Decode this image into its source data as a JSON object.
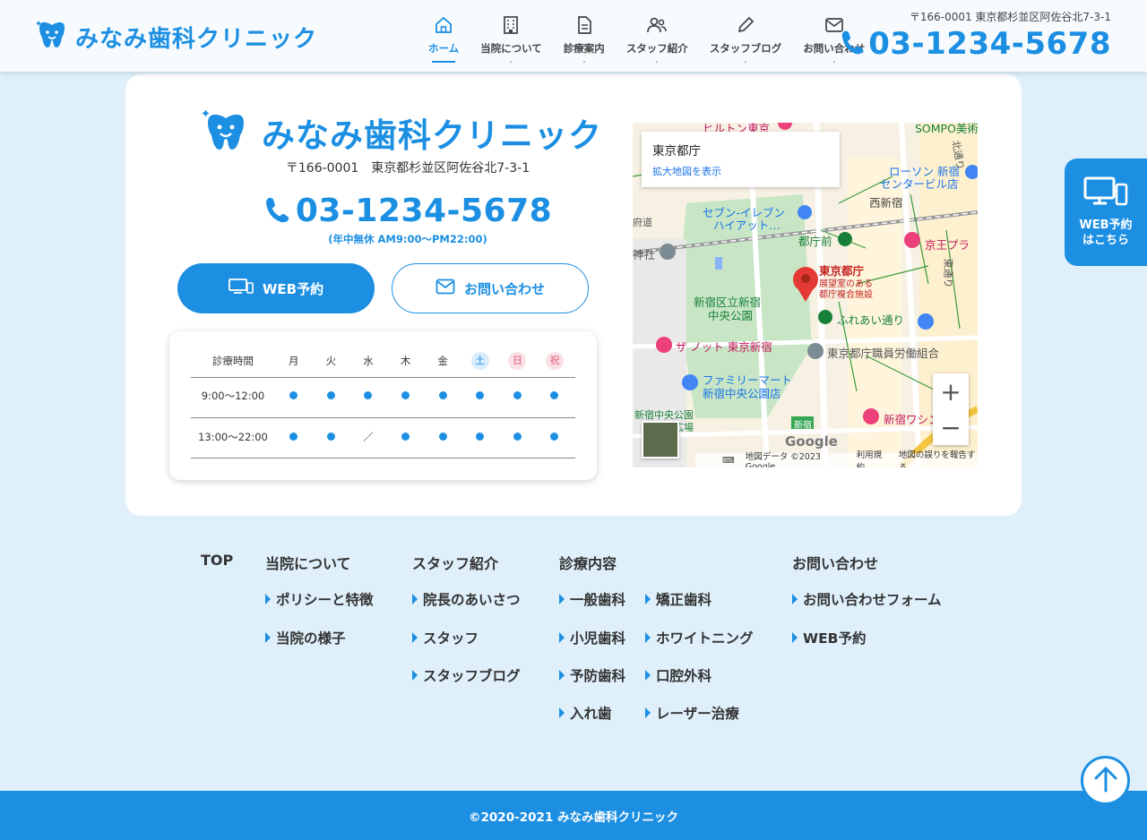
{
  "brand": {
    "name": "みなみ歯科クリニック",
    "accent": "#1c8fe3"
  },
  "header": {
    "nav": [
      {
        "label": "ホーム",
        "icon": "home-icon",
        "active": true
      },
      {
        "label": "当院について",
        "icon": "building-icon",
        "active": false
      },
      {
        "label": "診療案内",
        "icon": "document-icon",
        "active": false
      },
      {
        "label": "スタッフ紹介",
        "icon": "users-icon",
        "active": false
      },
      {
        "label": "スタッフブログ",
        "icon": "pencil-icon",
        "active": false
      },
      {
        "label": "お問い合わせ",
        "icon": "mail-icon",
        "active": false
      }
    ],
    "address": "〒166-0001 東京都杉並区阿佐谷北7-3-1",
    "phone": "03-1234-5678"
  },
  "card": {
    "address": "〒166-0001　東京都杉並区阿佐谷北7-3-1",
    "phone": "03-1234-5678",
    "hours_note": "(年中無休 AM9:00〜PM22:00)",
    "web_button": "WEB予約",
    "contact_button": "お問い合わせ"
  },
  "schedule": {
    "header_label": "診療時間",
    "days": [
      "月",
      "火",
      "水",
      "木",
      "金",
      "土",
      "日",
      "祝"
    ],
    "rows": [
      {
        "time": "9:00〜12:00",
        "slots": [
          "●",
          "●",
          "●",
          "●",
          "●",
          "●",
          "●",
          "●"
        ]
      },
      {
        "time": "13:00〜22:00",
        "slots": [
          "●",
          "●",
          "／",
          "●",
          "●",
          "●",
          "●",
          "●"
        ]
      }
    ]
  },
  "map": {
    "info_title": "東京都庁",
    "info_link": "拡大地図を表示",
    "zoom_in": "+",
    "zoom_out": "−",
    "labels": {
      "tocho": "東京都庁",
      "tocho_sub1": "展望室のある",
      "tocho_sub2": "都庁複合施設",
      "seven": "セブン-イレブン",
      "seven2": "ハイアット…",
      "lawson": "ローソン 新宿",
      "lawson2": "センタービル店",
      "nishishinjuku": "西新宿",
      "toshomae": "都庁前",
      "keio": "京王プラ",
      "park": "新宿区立新宿",
      "park2": "中央公園",
      "fureai": "ふれあい通り",
      "knot": "ザ ノット 東京新宿",
      "union": "東京都庁職員労働組合",
      "family": "ファミリーマート",
      "family2": "新宿中央公園店",
      "park_square": "新宿中央公園",
      "park_square2": "水の広場",
      "washington": "新宿ワシン",
      "hilton": "ヒルトン東京",
      "sompo": "SOMPO美術",
      "shrine": "神社",
      "shinjuku_badge": "新宿",
      "higashi": "東通り",
      "kita": "北通り",
      "fuchu": "府道"
    },
    "google": "Google",
    "footer": [
      "地図データ ©2023 Google",
      "利用規約",
      "地図の誤りを報告する"
    ]
  },
  "side_button": {
    "line1": "WEB予約",
    "line2": "はこちら"
  },
  "footer_nav": {
    "top": "TOP",
    "about": {
      "title": "当院について",
      "links": [
        "ポリシーと特徴",
        "当院の様子"
      ]
    },
    "staff": {
      "title": "スタッフ紹介",
      "links": [
        "院長のあいさつ",
        "スタッフ",
        "スタッフブログ"
      ]
    },
    "treatment": {
      "title": "診療内容",
      "col1": [
        "一般歯科",
        "小児歯科",
        "予防歯科",
        "入れ歯"
      ],
      "col2": [
        "矯正歯科",
        "ホワイトニング",
        "口腔外科",
        "レーザー治療"
      ]
    },
    "contact": {
      "title": "お問い合わせ",
      "links": [
        "お問い合わせフォーム",
        "WEB予約"
      ]
    }
  },
  "copyright": "©2020-2021 みなみ歯科クリニック"
}
